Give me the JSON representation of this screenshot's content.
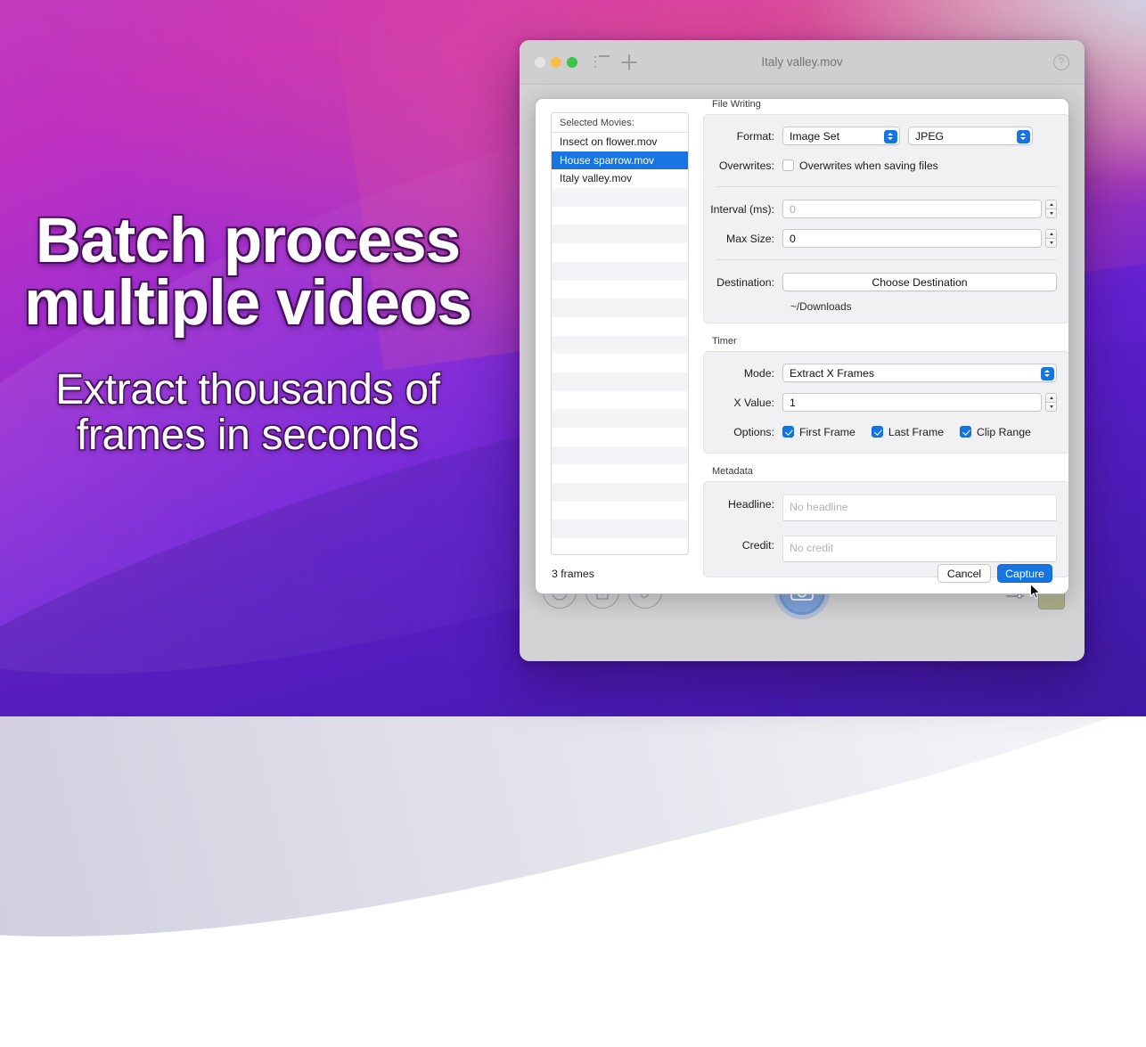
{
  "marketing": {
    "headline": "Batch process multiple videos",
    "subheadline": "Extract thousands of frames in seconds"
  },
  "window": {
    "title": "Italy valley.mov",
    "traffic_lights": [
      "close",
      "minimize",
      "maximize"
    ],
    "toolbar_icons": [
      "list-icon",
      "plus-icon"
    ],
    "help_glyph": "?"
  },
  "background_toolbar": {
    "icons": [
      "timer-icon",
      "share-icon",
      "paperclip-icon",
      "camera-icon",
      "sliders-icon",
      "thumbnail"
    ]
  },
  "sheet": {
    "movie_list": {
      "header": "Selected Movies:",
      "items": [
        {
          "name": "Insect on flower.mov",
          "selected": false
        },
        {
          "name": "House sparrow.mov",
          "selected": true
        },
        {
          "name": "Italy valley.mov",
          "selected": false
        }
      ]
    },
    "file_writing": {
      "title": "File Writing",
      "format_label": "Format:",
      "format_value": "Image Set",
      "codec_value": "JPEG",
      "overwrites_label": "Overwrites:",
      "overwrites_checkbox_label": "Overwrites when saving files",
      "overwrites_checked": false,
      "interval_label": "Interval (ms):",
      "interval_value": "0",
      "max_size_label": "Max Size:",
      "max_size_value": "0",
      "destination_label": "Destination:",
      "destination_button": "Choose Destination",
      "destination_path": "~/Downloads"
    },
    "timer": {
      "title": "Timer",
      "mode_label": "Mode:",
      "mode_value": "Extract X Frames",
      "x_value_label": "X Value:",
      "x_value": "1",
      "options_label": "Options:",
      "options": [
        {
          "label": "First Frame",
          "checked": true
        },
        {
          "label": "Last Frame",
          "checked": true
        },
        {
          "label": "Clip Range",
          "checked": true
        }
      ]
    },
    "metadata": {
      "title": "Metadata",
      "headline_label": "Headline:",
      "headline_placeholder": "No headline",
      "credit_label": "Credit:",
      "credit_placeholder": "No credit"
    },
    "footer": {
      "status": "3 frames",
      "cancel": "Cancel",
      "capture": "Capture"
    }
  },
  "colors": {
    "accent_blue": "#1675e0",
    "selection_blue": "#1675e0",
    "window_chrome": "#cfced0"
  }
}
